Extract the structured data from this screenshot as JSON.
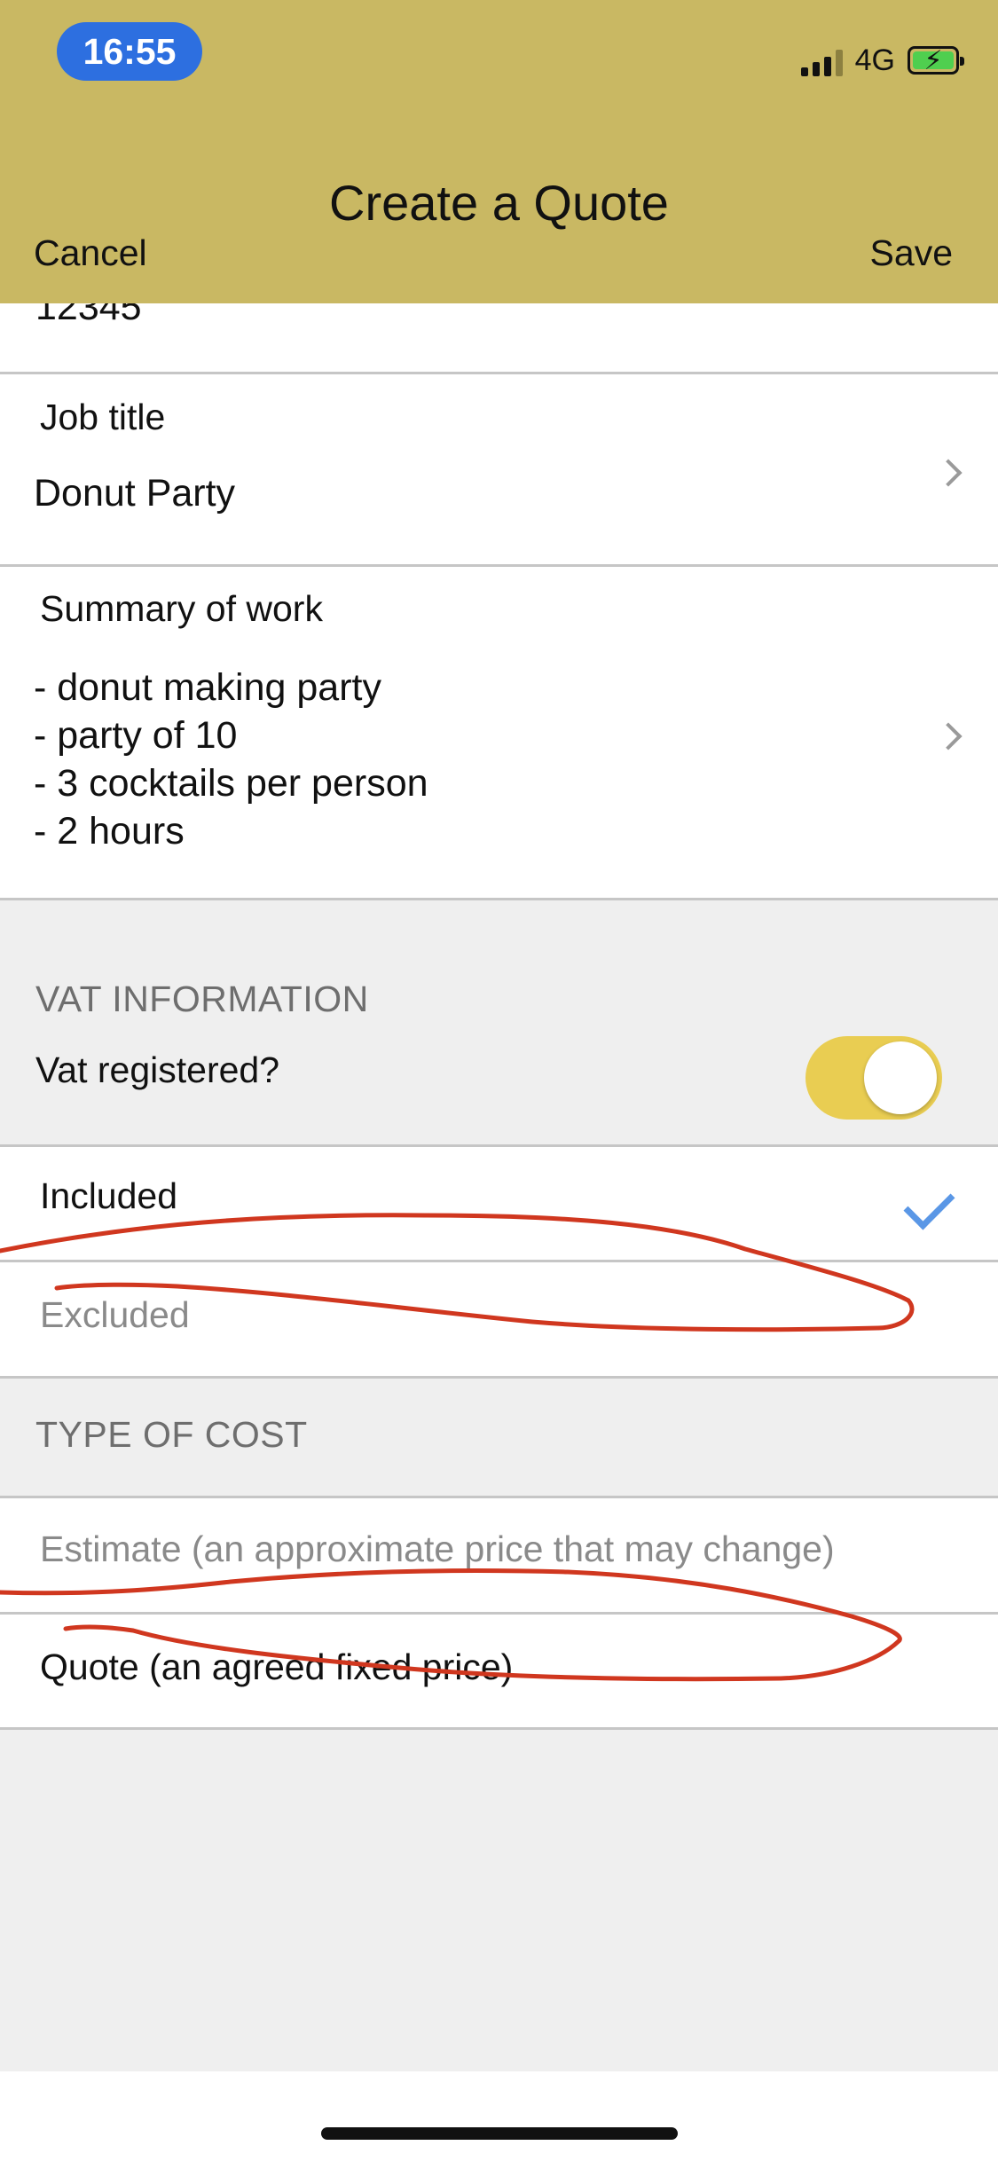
{
  "status_bar": {
    "time": "16:55",
    "network": "4G"
  },
  "header": {
    "title": "Create a Quote",
    "cancel_label": "Cancel",
    "save_label": "Save"
  },
  "scrolled_value": "12345",
  "job": {
    "label": "Job title",
    "value": "Donut Party"
  },
  "summary": {
    "label": "Summary of work",
    "lines": [
      "- donut making party",
      "- party of 10",
      "- 3 cocktails per person",
      "- 2 hours"
    ]
  },
  "vat": {
    "section_title": "VAT INFORMATION",
    "toggle_label": "Vat registered?",
    "toggle_on": true,
    "options": [
      {
        "label": "Included",
        "selected": true
      },
      {
        "label": "Excluded",
        "selected": false
      }
    ]
  },
  "cost": {
    "section_title": "TYPE OF COST",
    "options": [
      {
        "label": "Estimate (an approximate price that may change)",
        "selected": false
      },
      {
        "label": "Quote (an agreed fixed price)",
        "selected": false
      }
    ]
  },
  "colors": {
    "header_bg": "#c9b863",
    "time_pill": "#2d6fe0",
    "toggle_on": "#e9cd52",
    "checkmark": "#5a97e6",
    "annotation_ink": "#d0371f"
  }
}
